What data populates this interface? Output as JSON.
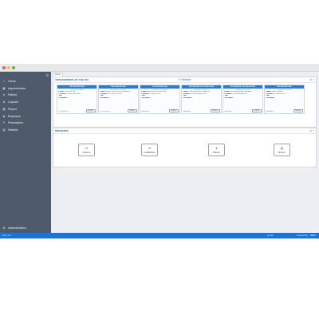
{
  "colors": {
    "sidebar": "#4e5b6b",
    "accent": "#2a7ad6",
    "statusbar": "#1e72d6",
    "in_progress": "#e07b1f",
    "available": "#2e8bd8"
  },
  "window_controls": [
    {
      "name": "close-dot",
      "color": "#ee5d55"
    },
    {
      "name": "minimize-dot",
      "color": "#f5bd3b"
    },
    {
      "name": "maximize-dot",
      "color": "#4dbd4a"
    }
  ],
  "sidebar": {
    "collapse_icon": "list-icon",
    "items": [
      {
        "icon": "home-icon",
        "label": "Home"
      },
      {
        "icon": "calendar-icon",
        "label": "Appointments"
      },
      {
        "icon": "user-icon",
        "label": "Patient"
      },
      {
        "icon": "camera-icon",
        "label": "Capture"
      },
      {
        "icon": "document-icon",
        "label": "Report"
      },
      {
        "icon": "users-icon",
        "label": "Employee"
      },
      {
        "icon": "prescription-icon",
        "label": "Prescription"
      },
      {
        "icon": "chart-icon",
        "label": "Statistic"
      }
    ],
    "footer": {
      "icon": "gear-icon",
      "label": "Administration"
    }
  },
  "tab": {
    "label": "Home"
  },
  "appointments": {
    "title": "APPOINTMENTS OF THE DAY",
    "refresh_label": "Refresh",
    "cards": [
      {
        "procedure": "PROCEDURE USA",
        "time": "09:00:00 - 9:30:00",
        "patient": "LIM PENG KIAT",
        "physician": "DR. LEE ZHOU MEI",
        "title": "",
        "description": "",
        "status": "In attendance",
        "button": "Go Back"
      },
      {
        "procedure": "PROCEDURE USA",
        "time": "09:30:00 - 10:00:00",
        "patient": "BEATE TRECKSTEIN SCHNEIDER",
        "physician": "DR. LEE ZHOU MEI",
        "title": "",
        "description": "",
        "status": "In attendance",
        "button": "Go Back"
      },
      {
        "procedure": "PROCEDURE USA",
        "time": "10:00:00 - 10:30:00",
        "patient": "ANDERSON SOUZA SILVA",
        "physician": "DR. ALVIN TOH",
        "title": "",
        "description": "",
        "status": "Available",
        "button": "Go Back"
      },
      {
        "procedure": "PROCEDURE COLONOSCOPIA",
        "time": "10:30:00 - 11:00:00",
        "patient": "JOAO BATISTA DOS SANTOS",
        "physician": "DR. MELISSA WONG",
        "title": "",
        "description": "",
        "status": "Available",
        "button": "Go Back"
      },
      {
        "procedure": "PROCEDURE COLONOSCOPIA",
        "time": "11:00:00 - 11:30:00",
        "patient": "LETICIA MIRANDA CARVALHO",
        "physician": "DR. MELISSA WONG",
        "title": "",
        "description": "",
        "status": "Available",
        "button": "Go Back"
      },
      {
        "procedure": "PROCEDURE USA",
        "time": "11:30:00 - 12:00:00",
        "patient": "TANG XIAOMEI",
        "physician": "DR. ALVIN TOH",
        "title": "",
        "description": "",
        "status": "Available",
        "button": "Go Back"
      }
    ],
    "field_labels": {
      "patient": "Patient:",
      "physician": "Physician:",
      "title": "Title:",
      "description": "Description:"
    }
  },
  "priorities": {
    "title": "PRIORITIES",
    "buttons": [
      {
        "icon": "camera-icon",
        "label": "Capture"
      },
      {
        "icon": "backup-icon",
        "label": "LiveBackup"
      },
      {
        "icon": "patient-icon",
        "label": "Patient"
      },
      {
        "icon": "report-icon",
        "label": "Report"
      }
    ]
  },
  "statusbar": {
    "left": "20.1  |  4.0",
    "right_a": "en-US",
    "right_b": "Powered by",
    "brand": "NEXT"
  }
}
